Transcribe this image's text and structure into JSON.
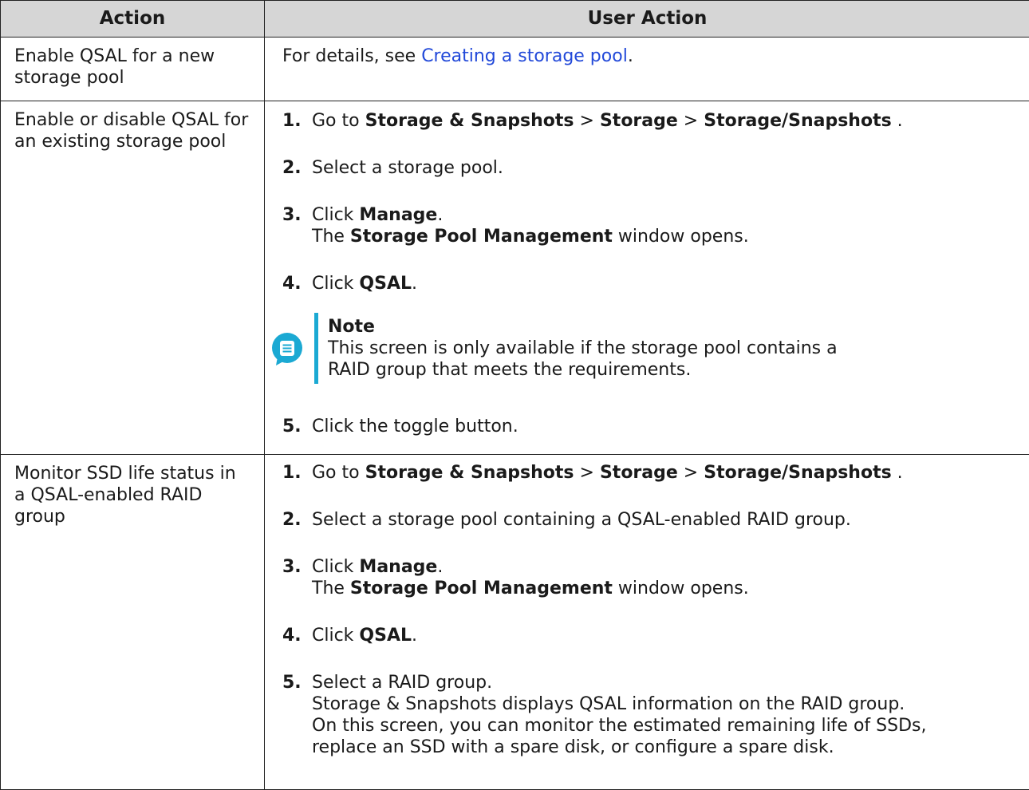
{
  "headers": {
    "action": "Action",
    "user_action": "User Action"
  },
  "row1": {
    "action": "Enable QSAL for a new storage pool",
    "pre": "For details, see ",
    "link": "Creating a storage pool",
    "post": "."
  },
  "row2": {
    "action": "Enable or disable QSAL for an existing storage pool",
    "s1": {
      "num": "1.",
      "pre": "Go to ",
      "b1": "Storage & Snapshots",
      "sep1": " > ",
      "b2": "Storage",
      "sep2": " > ",
      "b3": "Storage/Snapshots",
      "post": " ."
    },
    "s2": {
      "num": "2.",
      "text": "Select a storage pool."
    },
    "s3": {
      "num": "3.",
      "pre": "Click ",
      "b1": "Manage",
      "post": ".",
      "l2pre": "The ",
      "l2b": "Storage Pool Management",
      "l2post": " window opens."
    },
    "s4": {
      "num": "4.",
      "pre": "Click ",
      "b1": "QSAL",
      "post": "."
    },
    "note": {
      "title": "Note",
      "line1": "This screen is only available if the storage pool contains a",
      "line2": "RAID group that meets the requirements."
    },
    "s5": {
      "num": "5.",
      "text": "Click the toggle button."
    }
  },
  "row3": {
    "action": "Monitor SSD life status in a QSAL-enabled RAID group",
    "s1": {
      "num": "1.",
      "pre": "Go to ",
      "b1": "Storage & Snapshots",
      "sep1": " > ",
      "b2": "Storage",
      "sep2": " > ",
      "b3": "Storage/Snapshots",
      "post": " ."
    },
    "s2": {
      "num": "2.",
      "text": "Select a storage pool containing a QSAL-enabled RAID group."
    },
    "s3": {
      "num": "3.",
      "pre": "Click ",
      "b1": "Manage",
      "post": ".",
      "l2pre": "The ",
      "l2b": "Storage Pool Management",
      "l2post": " window opens."
    },
    "s4": {
      "num": "4.",
      "pre": "Click ",
      "b1": "QSAL",
      "post": "."
    },
    "s5": {
      "num": "5.",
      "line1": "Select a RAID group.",
      "line2": "Storage & Snapshots displays QSAL information on the RAID group.",
      "line3": "On this screen, you can monitor the estimated remaining life of SSDs,",
      "line4": "replace an SSD with a spare disk, or configure a spare disk."
    }
  },
  "colors": {
    "header_bg": "#d6d6d6",
    "link": "#2249d9",
    "note_accent": "#1ba9d3"
  },
  "icons": {
    "note": "note-bubble-icon"
  }
}
